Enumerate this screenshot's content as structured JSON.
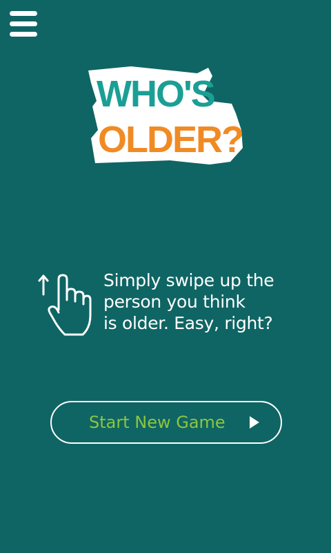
{
  "app": {
    "logo_line1": "WHO'S",
    "logo_line2": "OLDER?"
  },
  "menu": {
    "icon": "hamburger-menu-icon"
  },
  "instruction": {
    "icon": "swipe-up-hand-icon",
    "lines": [
      "Simply swipe up the",
      "person you think",
      "is older. Easy, right?"
    ]
  },
  "start_button": {
    "label": "Start New Game",
    "icon": "play-icon"
  },
  "colors": {
    "background": "#0f6564",
    "logo_teal": "#1b9f95",
    "logo_orange": "#f08b24",
    "button_text": "#8cc63f",
    "white": "#ffffff"
  }
}
